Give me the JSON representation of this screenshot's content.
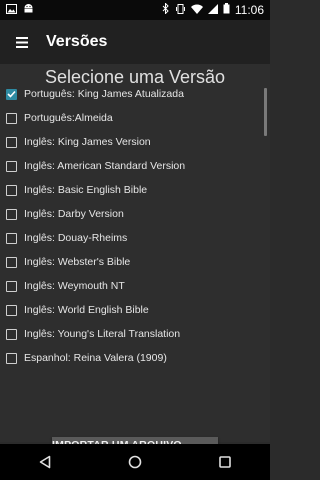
{
  "status_bar": {
    "time": "11:06",
    "left_icons": [
      "gallery-icon",
      "android-icon"
    ],
    "right_icons": [
      "bluetooth-icon",
      "vibrate-icon",
      "wifi-icon",
      "signal-icon",
      "battery-icon"
    ]
  },
  "toolbar": {
    "title": "Versões"
  },
  "main": {
    "heading": "Selecione uma Versão",
    "items": [
      {
        "label": "Português: King James Atualizada",
        "checked": true
      },
      {
        "label": "Português:Almeida",
        "checked": false
      },
      {
        "label": "Inglês: King James Version",
        "checked": false
      },
      {
        "label": "Inglês: American Standard Version",
        "checked": false
      },
      {
        "label": "Inglês: Basic English Bible",
        "checked": false
      },
      {
        "label": "Inglês: Darby Version",
        "checked": false
      },
      {
        "label": "Inglês: Douay-Rheims",
        "checked": false
      },
      {
        "label": "Inglês: Webster's Bible",
        "checked": false
      },
      {
        "label": "Inglês: Weymouth NT",
        "checked": false
      },
      {
        "label": "Inglês: World English Bible",
        "checked": false
      },
      {
        "label": "Inglês: Young's Literal Translation",
        "checked": false
      },
      {
        "label": "Espanhol: Reina Valera (1909)",
        "checked": false
      }
    ],
    "import_button": "IMPORTAR UM ARQUIVO SQLITE"
  },
  "nav_bar": {
    "icons": [
      "back-icon",
      "home-icon",
      "recents-icon"
    ]
  },
  "colors": {
    "accent": "#2e8ba3",
    "toolbar": "#212121",
    "background": "#2e2e2e"
  }
}
